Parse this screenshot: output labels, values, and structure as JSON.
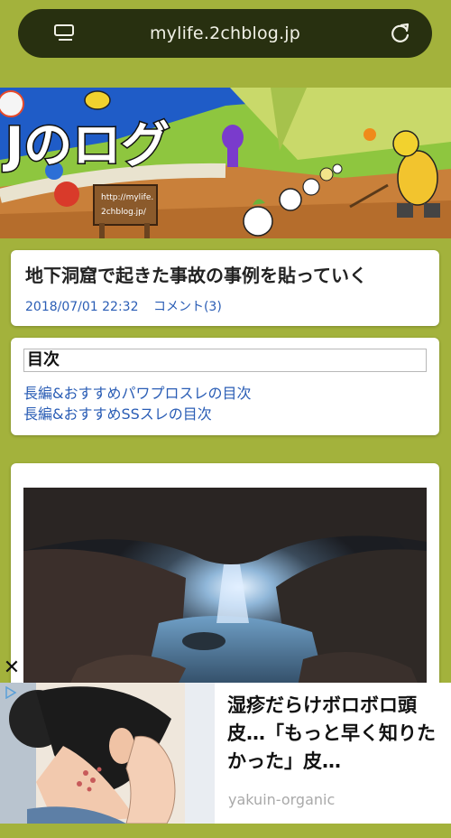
{
  "browser": {
    "url": "mylife.2chblog.jp",
    "menu_icon": "reader-menu-icon",
    "reload_icon": "reload-icon"
  },
  "banner": {
    "logo_text": "Jのログ",
    "sign_text_line1": "http://mylife.",
    "sign_text_line2": "2chblog.jp/"
  },
  "article": {
    "title": "地下洞窟で起きた事故の事例を貼っていく",
    "date": "2018/07/01 22:32",
    "comments": "コメント(3)"
  },
  "toc": {
    "heading": "目次",
    "links": [
      "長編&おすすめパワプロスレの目次",
      "長編&おすすめSSスレの目次"
    ]
  },
  "ad": {
    "close_label": "✕",
    "title": "湿疹だらけボロボロ頭皮…「もっと早く知りたかった」皮…",
    "source": "yakuin-organic"
  },
  "colors": {
    "page_bg": "#a3b23c",
    "url_bar_bg": "#283010",
    "link": "#2a5db5"
  }
}
